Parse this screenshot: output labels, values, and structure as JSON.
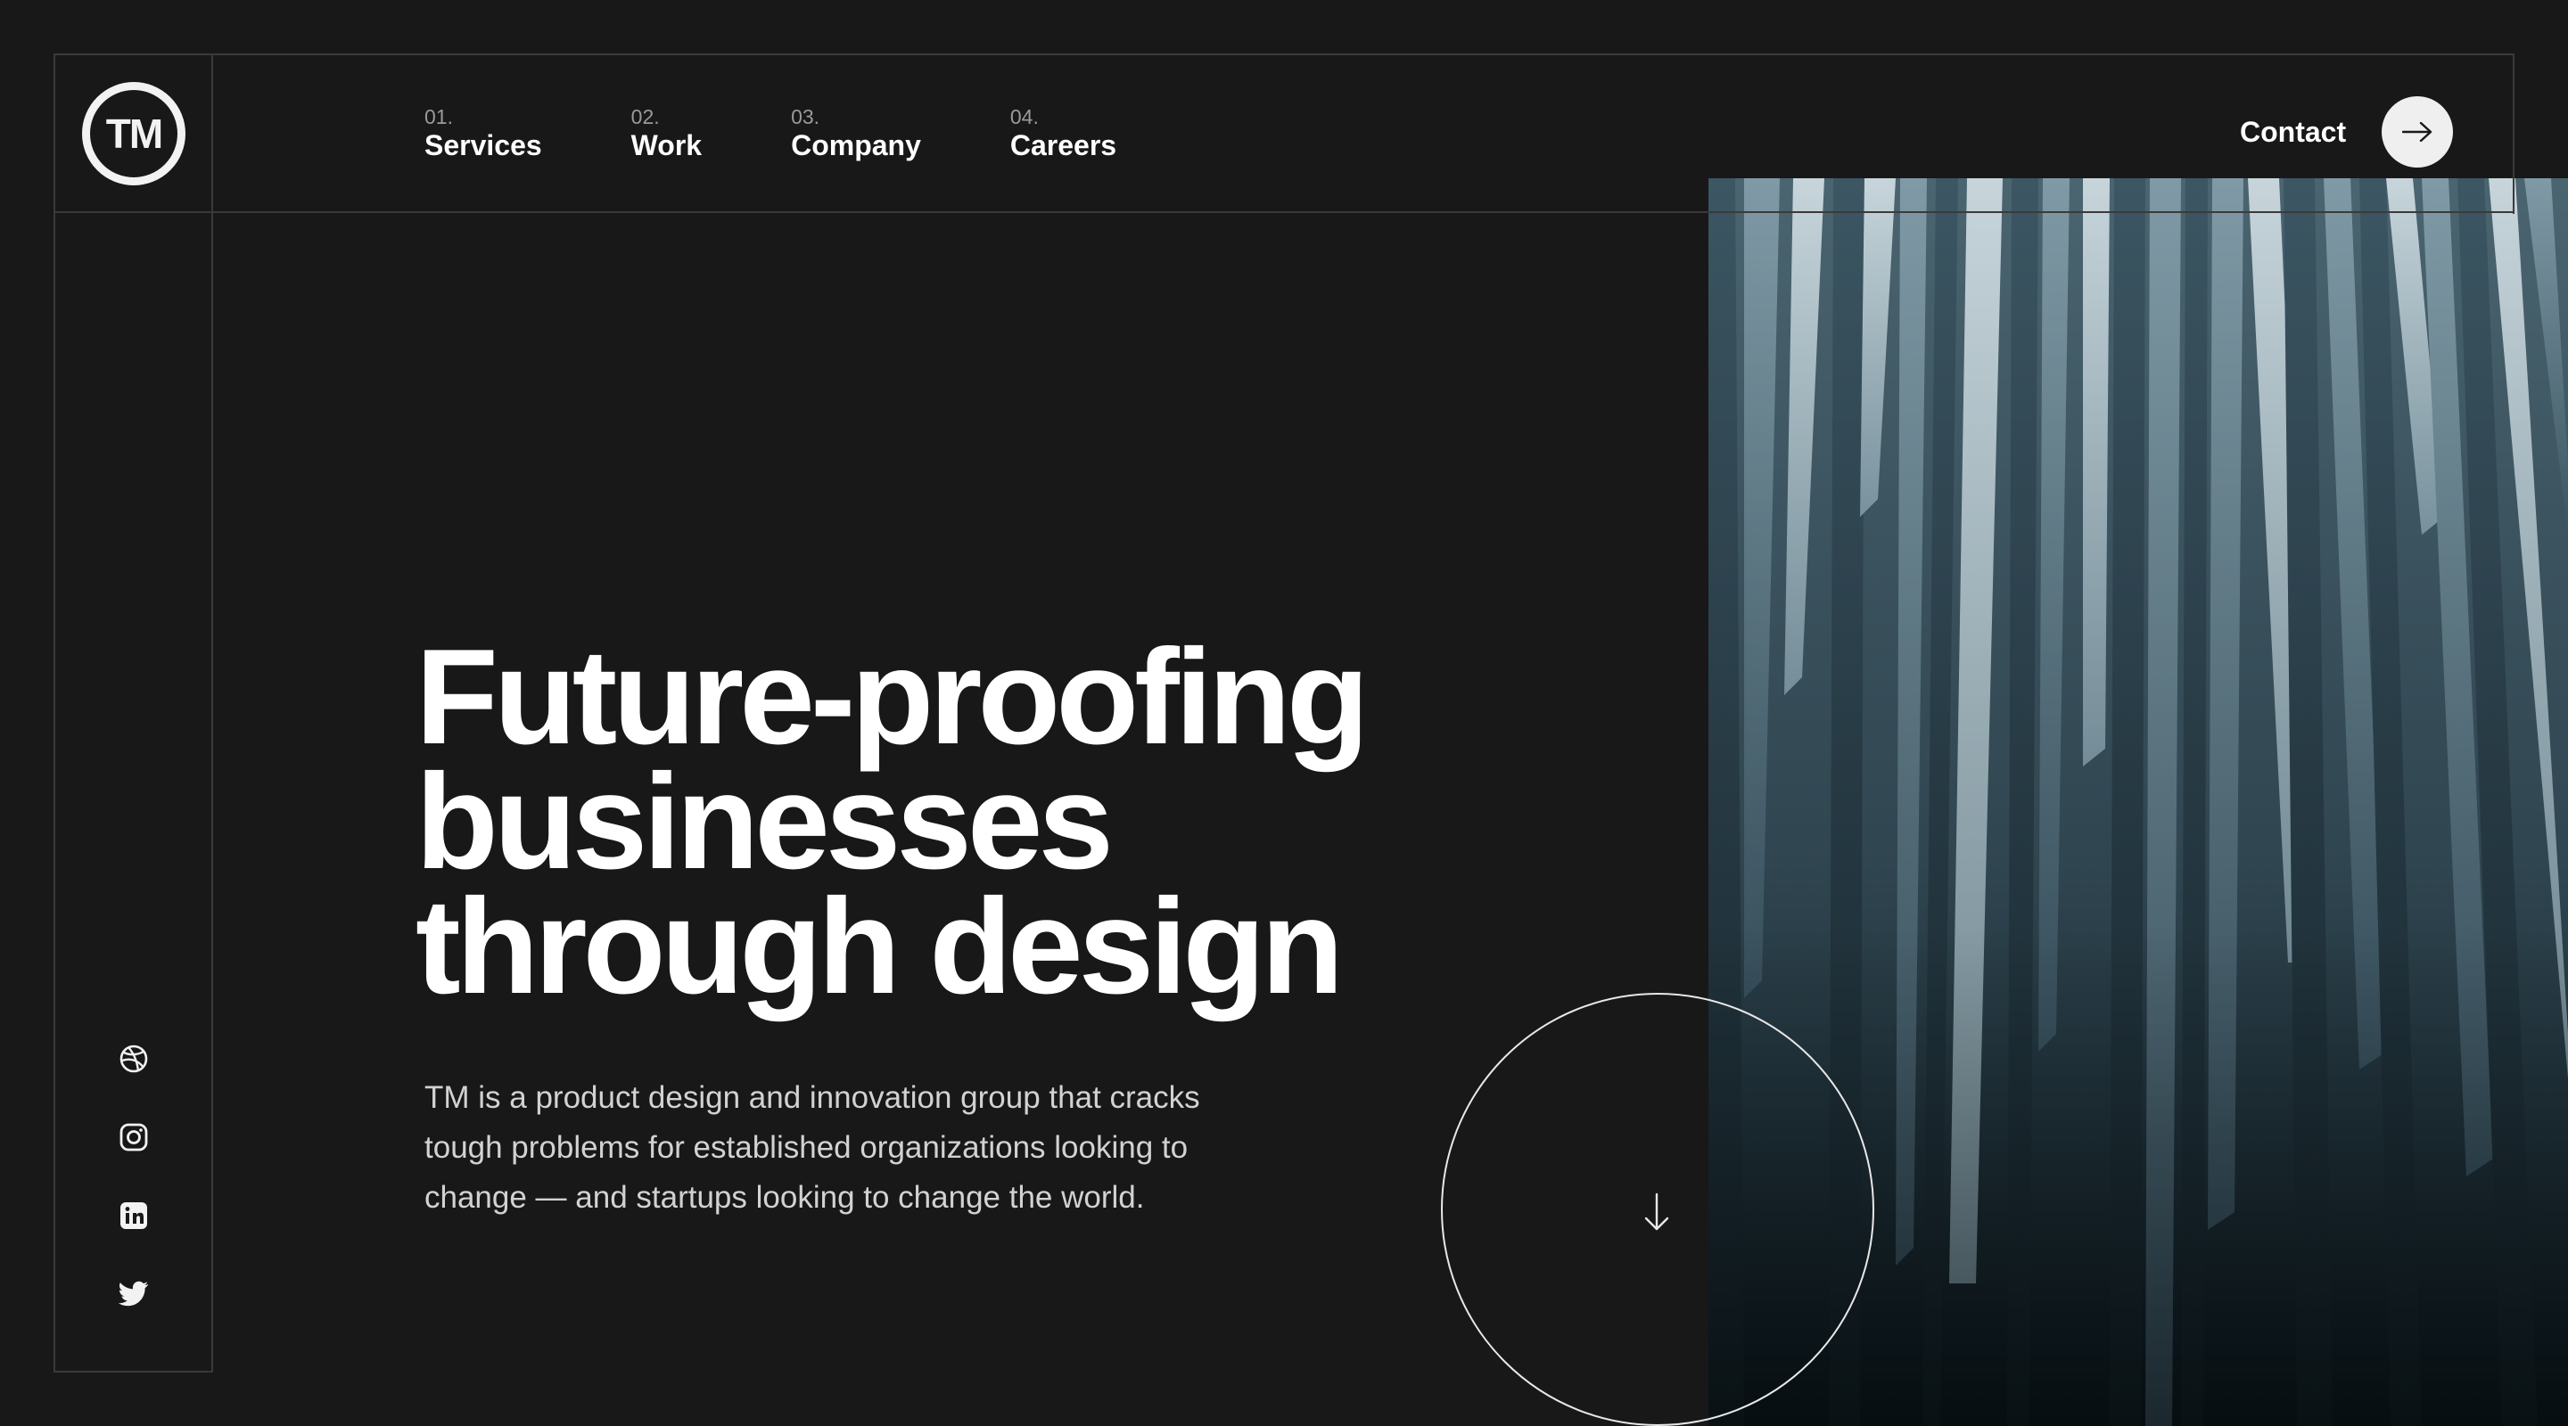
{
  "brand": {
    "logo_text": "TM"
  },
  "nav": {
    "items": [
      {
        "num": "01.",
        "label": "Services"
      },
      {
        "num": "02.",
        "label": "Work"
      },
      {
        "num": "03.",
        "label": "Company"
      },
      {
        "num": "04.",
        "label": "Careers"
      }
    ]
  },
  "contact": {
    "label": "Contact",
    "icon": "arrow-right-icon"
  },
  "hero": {
    "headline": [
      "Future-proofing",
      "businesses",
      "through design"
    ],
    "description": "TM is a product design and innovation group that cracks tough problems for established organizations looking to change — and startups looking to change the world.",
    "scroll_icon": "arrow-down-icon"
  },
  "socials": [
    "dribbble-icon",
    "instagram-icon",
    "linkedin-icon",
    "twitter-icon"
  ],
  "colors": {
    "background": "#181818",
    "text": "#ffffff",
    "muted": "#9a9a9a",
    "line": "#3a3a3a",
    "image_tint": "#4f6b78"
  }
}
